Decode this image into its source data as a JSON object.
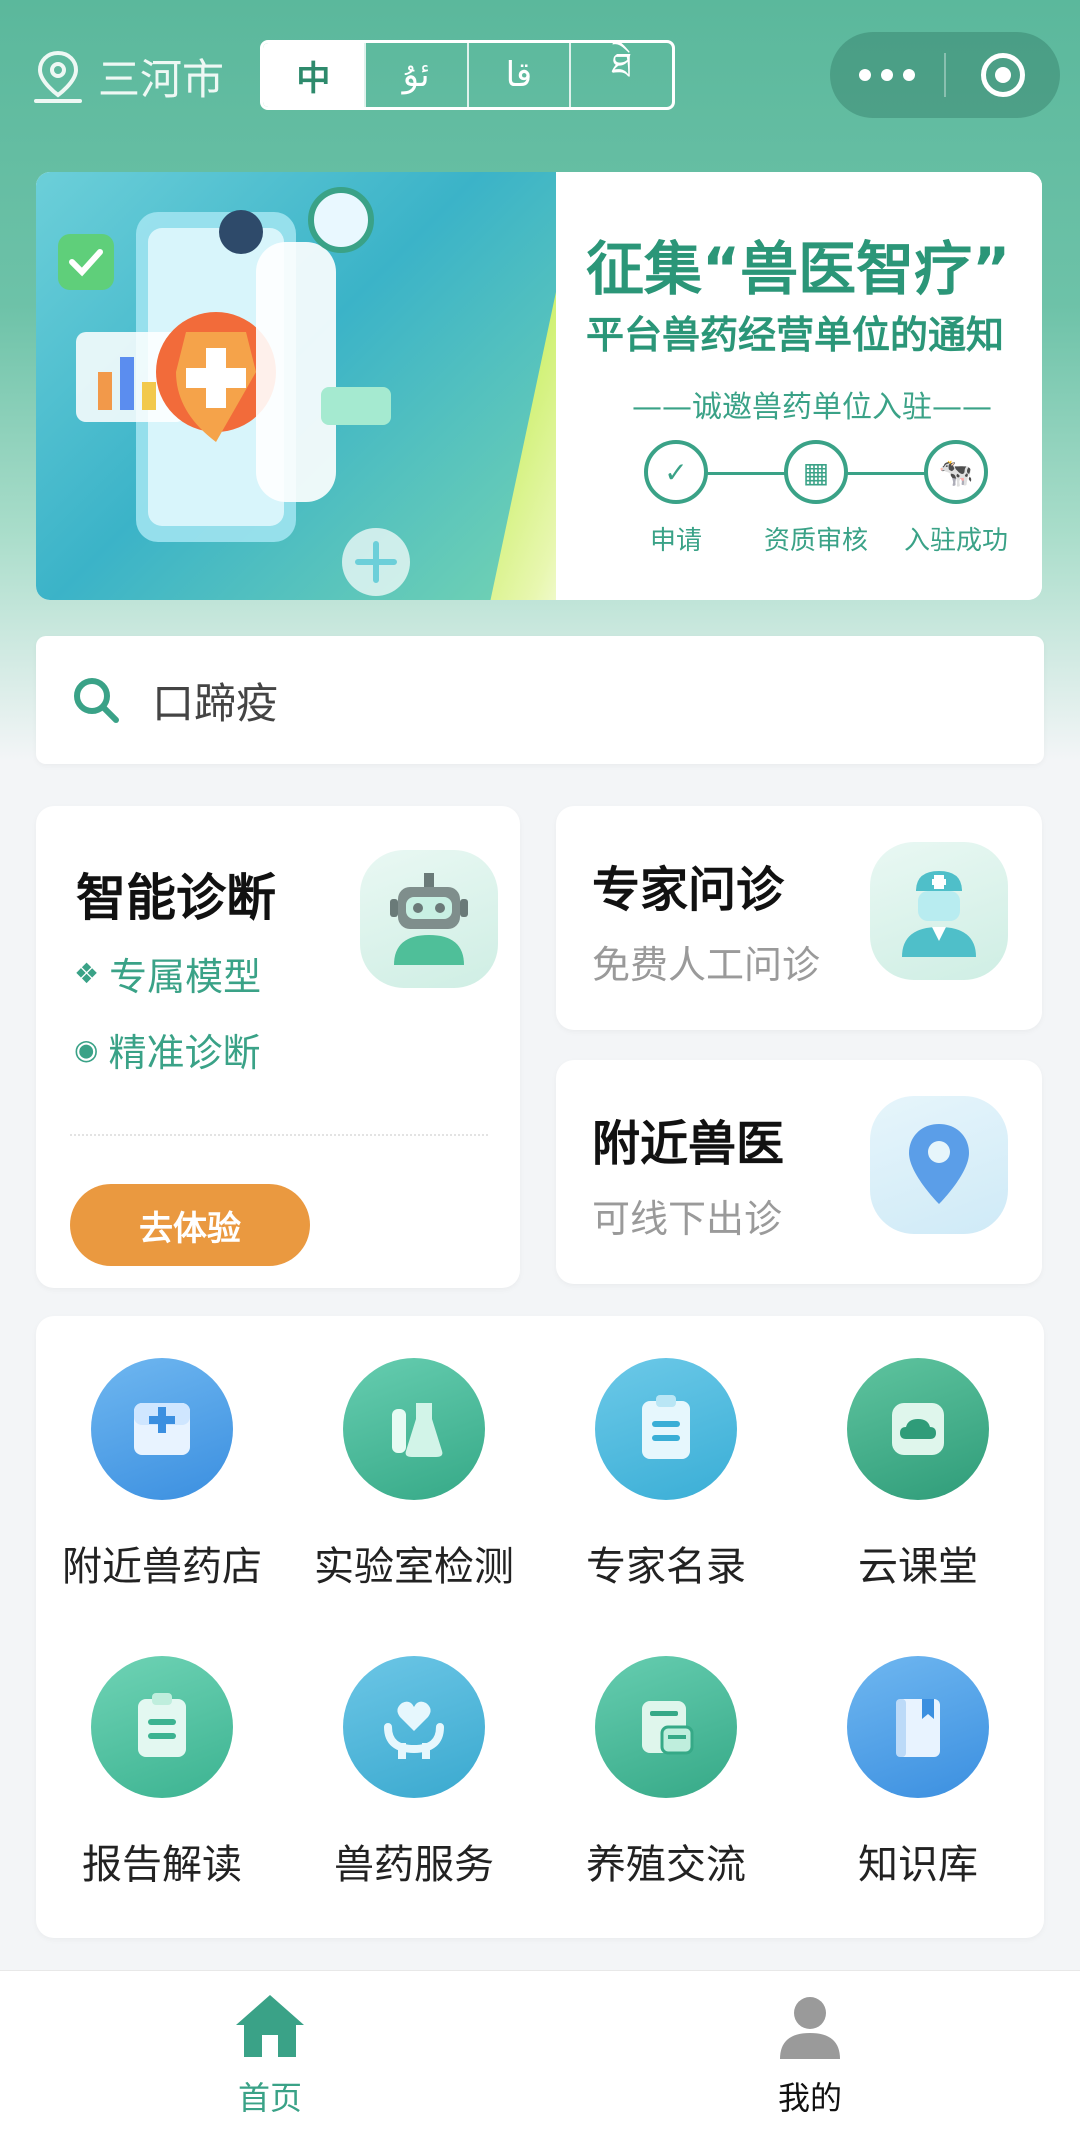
{
  "header": {
    "location": "三河市",
    "languages": [
      "中",
      "ئۇ",
      "قا",
      "ཐེ"
    ]
  },
  "banner": {
    "title": "征集“兽医智疗”",
    "subtitle": "平台兽药经营单位的通知",
    "invite": "——诚邀兽药单位入驻——",
    "steps": [
      "申请",
      "资质审核",
      "入驻成功"
    ]
  },
  "search": {
    "placeholder": "口蹄疫"
  },
  "ai_card": {
    "title": "智能诊断",
    "features": [
      "专属模型",
      "精准诊断"
    ],
    "button": "去体验"
  },
  "expert_card": {
    "title": "专家问诊",
    "subtitle": "免费人工问诊"
  },
  "vet_card": {
    "title": "附近兽医",
    "subtitle": "可线下出诊"
  },
  "services": [
    {
      "label": "附近兽药店",
      "icon": "medicine-box-icon"
    },
    {
      "label": "实验室检测",
      "icon": "flask-icon"
    },
    {
      "label": "专家名录",
      "icon": "clipboard-icon"
    },
    {
      "label": "云课堂",
      "icon": "cloud-class-icon"
    },
    {
      "label": "报告解读",
      "icon": "report-icon"
    },
    {
      "label": "兽药服务",
      "icon": "heart-hand-icon"
    },
    {
      "label": "养殖交流",
      "icon": "chat-doc-icon"
    },
    {
      "label": "知识库",
      "icon": "book-icon"
    }
  ],
  "tabbar": {
    "items": [
      {
        "label": "首页",
        "icon": "home-icon",
        "active": true
      },
      {
        "label": "我的",
        "icon": "user-icon",
        "active": false
      }
    ]
  },
  "colors": {
    "brand": "#3aa287",
    "accent": "#ea9940",
    "header": "#5bb89c"
  }
}
